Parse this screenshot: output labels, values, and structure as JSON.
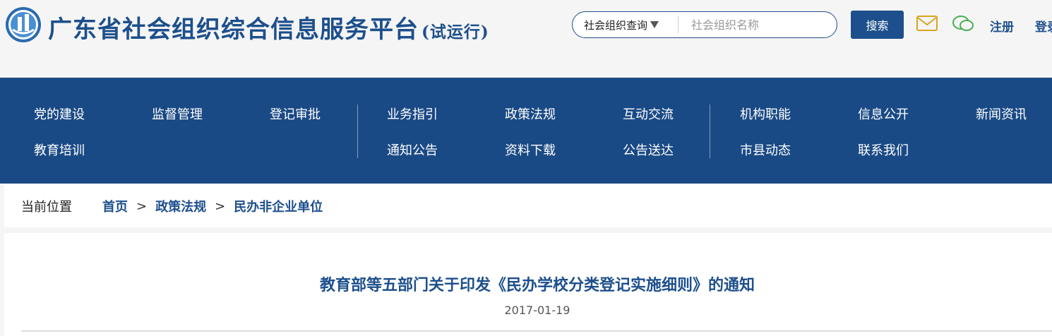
{
  "header": {
    "site_title": "广东省社会组织综合信息服务平台",
    "trial_note": "(试运行)",
    "search": {
      "select_value": "社会组织查询",
      "placeholder": "社会组织名称",
      "button_label": "搜索"
    },
    "links": {
      "register": "注册",
      "login": "登录"
    },
    "icons": {
      "mail": "mail-icon",
      "chat": "chat-icon"
    }
  },
  "nav": {
    "items": [
      "党的建设",
      "监督管理",
      "登记审批",
      "业务指引",
      "政策法规",
      "互动交流",
      "机构职能",
      "信息公开",
      "新闻资讯",
      "教育培训",
      "通知公告",
      "资料下载",
      "公告送达",
      "市县动态",
      "联系我们"
    ]
  },
  "breadcrumb": {
    "label": "当前位置",
    "items": [
      "首页",
      "政策法规",
      "民办非企业单位"
    ],
    "separator": ">"
  },
  "article": {
    "title": "教育部等五部门关于印发《民办学校分类登记实施细则》的通知",
    "date": "2017-01-19"
  },
  "colors": {
    "brand": "#1d4f8c",
    "nav_bg": "#1a4a85",
    "mail": "#d9a520",
    "chat": "#4caf50"
  }
}
